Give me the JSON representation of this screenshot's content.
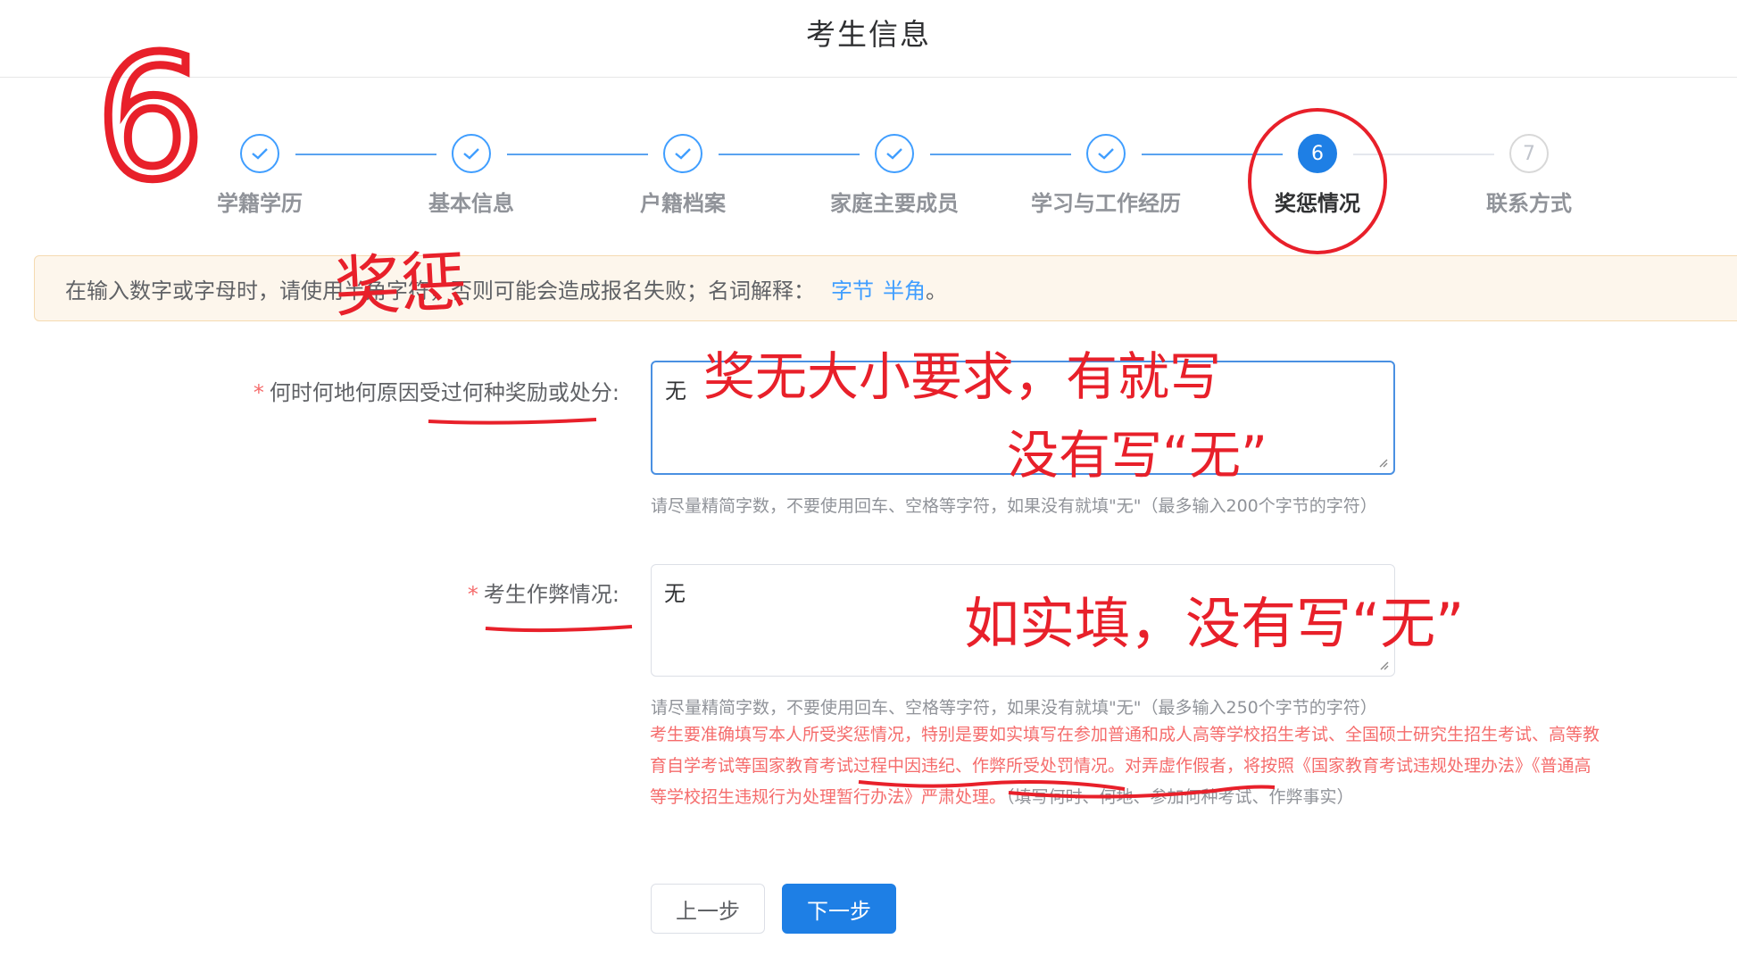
{
  "header": {
    "title": "考生信息"
  },
  "steps": [
    {
      "label": "学籍学历",
      "state": "done",
      "number": "1"
    },
    {
      "label": "基本信息",
      "state": "done",
      "number": "2"
    },
    {
      "label": "户籍档案",
      "state": "done",
      "number": "3"
    },
    {
      "label": "家庭主要成员",
      "state": "done",
      "number": "4"
    },
    {
      "label": "学习与工作经历",
      "state": "done",
      "number": "5"
    },
    {
      "label": "奖惩情况",
      "state": "active",
      "number": "6"
    },
    {
      "label": "联系方式",
      "state": "todo",
      "number": "7"
    }
  ],
  "notice": {
    "text": "在输入数字或字母时，请使用半角字符，否则可能会造成报名失败；名词解释：",
    "link_bytes": "字节",
    "link_halfwidth": "半角",
    "tail": "。"
  },
  "form": {
    "rewards": {
      "label": "何时何地何原因受过何种奖励或处分:",
      "value": "无",
      "hint": "请尽量精简字数，不要使用回车、空格等字符，如果没有就填\"无\"（最多输入200个字节的字符）"
    },
    "cheating": {
      "label": "考生作弊情况:",
      "value": "无",
      "hint": "请尽量精简字数，不要使用回车、空格等字符，如果没有就填\"无\"（最多输入250个字节的字符）"
    },
    "warning": "考生要准确填写本人所受奖惩情况，特别是要如实填写在参加普通和成人高等学校招生考试、全国硕士研究生招生考试、高等教育自学考试等国家教育考试过程中因违纪、作弊所受处罚情况。对弄虚作假者，将按照《国家教育考试违规处理办法》《普通高等学校招生违规行为处理暂行办法》严肃处理。",
    "warning_grey": "（填写何时、何地、参加何种考试、作弊事实）"
  },
  "buttons": {
    "prev": "上一步",
    "next": "下一步"
  },
  "annotations": {
    "big_number": "6",
    "title_note": "奖惩",
    "rewards_note_1": "奖无大小要求，有就写",
    "rewards_note_2": "没有写“无”",
    "cheating_note": "如实填，没有写“无”"
  },
  "colors": {
    "primary": "#1e7fe5",
    "annotation_red": "#e8202a",
    "warning_red": "#f56c6c",
    "notice_bg": "#fdf6ec"
  }
}
